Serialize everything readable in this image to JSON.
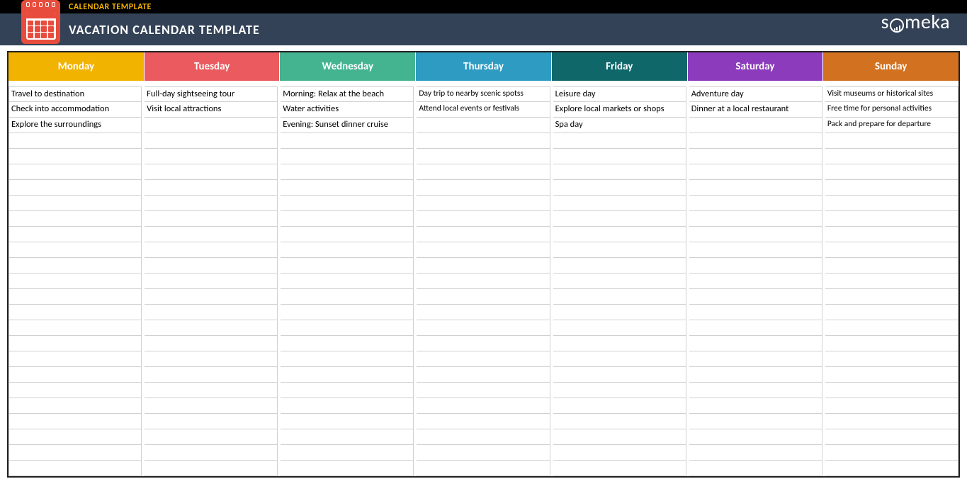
{
  "header": {
    "top_label": "CALENDAR TEMPLATE",
    "title": "VACATION CALENDAR TEMPLATE",
    "brand": "someka"
  },
  "days": [
    {
      "name": "Monday",
      "color": "#f2b200",
      "items": [
        "Travel to destination",
        "Check into accommodation",
        "Explore the surroundings"
      ],
      "small": false
    },
    {
      "name": "Tuesday",
      "color": "#ea5a5e",
      "items": [
        "Full-day sightseeing tour",
        "Visit local attractions",
        ""
      ],
      "small": false
    },
    {
      "name": "Wednesday",
      "color": "#43b48f",
      "items": [
        "Morning: Relax at the beach",
        "Water activities",
        "Evening: Sunset dinner cruise"
      ],
      "small": false
    },
    {
      "name": "Thursday",
      "color": "#2d9bc2",
      "items": [
        "Day trip to nearby scenic spotss",
        "Attend local events or festivals",
        ""
      ],
      "small": true
    },
    {
      "name": "Friday",
      "color": "#0f6769",
      "items": [
        "Leisure day",
        "Explore local markets or shops",
        "Spa day"
      ],
      "small": false
    },
    {
      "name": "Saturday",
      "color": "#8b3bbb",
      "items": [
        "Adventure day",
        "Dinner at a local restaurant",
        ""
      ],
      "small": false
    },
    {
      "name": "Sunday",
      "color": "#d2711f",
      "items": [
        "Visit museums or historical sites",
        "Free time for personal activities",
        "Pack and prepare for departure"
      ],
      "small": true
    }
  ],
  "rows_per_day": 25
}
